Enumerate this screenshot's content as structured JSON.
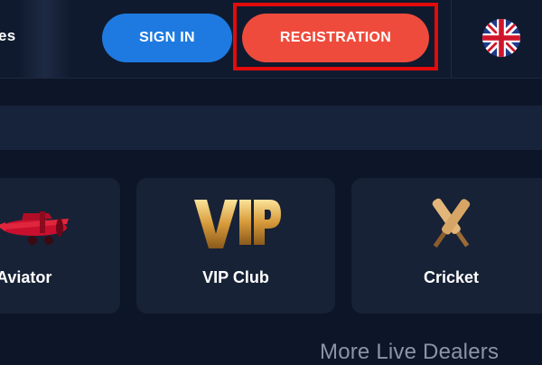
{
  "header": {
    "nav_partial": "es",
    "signin_label": "SIGN IN",
    "register_label": "REGISTRATION",
    "language": "English (UK flag)"
  },
  "cards": [
    {
      "label": "Aviator",
      "icon": "airplane-icon"
    },
    {
      "label": "VIP Club",
      "icon": "vip-icon"
    },
    {
      "label": "Cricket",
      "icon": "cricket-bats-icon"
    }
  ],
  "more_link": "More Live Dealers",
  "colors": {
    "background": "#0d1628",
    "header": "#101a2e",
    "card": "#172236",
    "signin": "#1e7ae0",
    "register": "#ef4b3c",
    "highlight": "#e20b0b"
  }
}
